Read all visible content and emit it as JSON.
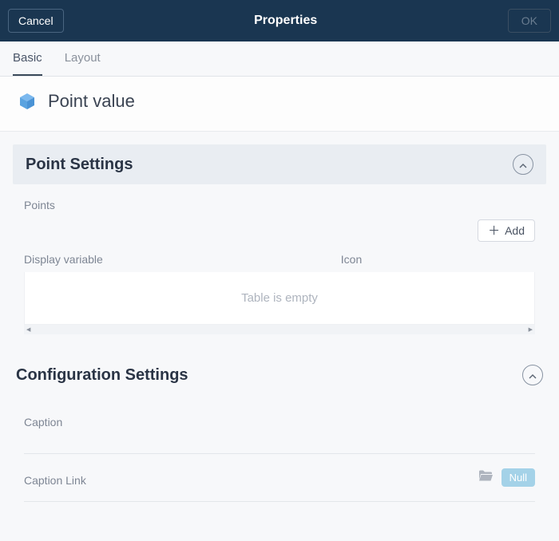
{
  "header": {
    "cancel_label": "Cancel",
    "title": "Properties",
    "ok_label": "OK"
  },
  "tabs": {
    "basic": "Basic",
    "layout": "Layout"
  },
  "page": {
    "title": "Point value"
  },
  "point_settings": {
    "section_title": "Point Settings",
    "points_label": "Points",
    "add_label": "Add",
    "columns": {
      "display_variable": "Display variable",
      "icon": "Icon"
    },
    "empty_text": "Table is empty"
  },
  "config_settings": {
    "section_title": "Configuration Settings",
    "caption_label": "Caption",
    "caption_link_label": "Caption Link",
    "null_label": "Null"
  }
}
